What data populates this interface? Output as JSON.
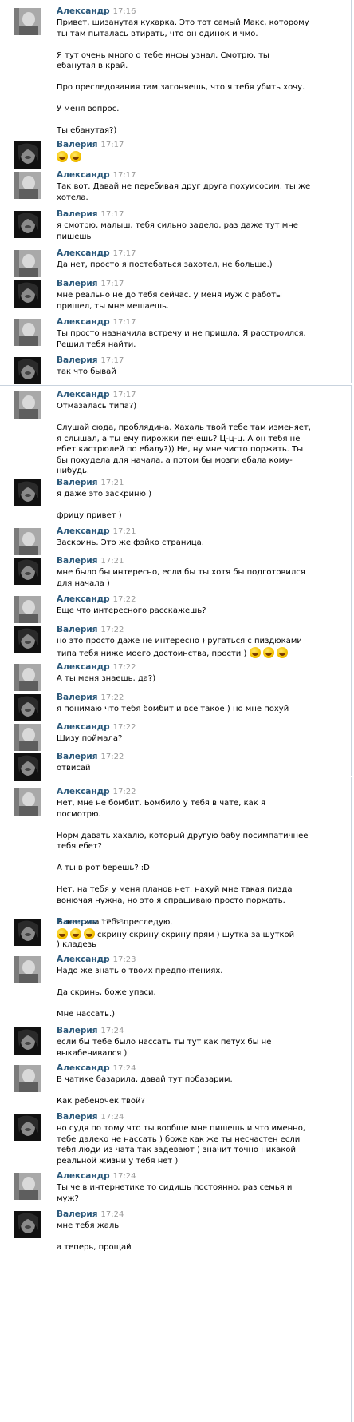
{
  "authors": {
    "alex": "Александр",
    "val": "Валерия"
  },
  "colors": {
    "author": "#2b587a",
    "time": "#999999",
    "border": "#c9d3de",
    "emoji": "#f5c400"
  },
  "messages": [
    {
      "a": "alex",
      "t": "17:16",
      "lines": [
        "Привет, шизанутая кухарка. Это тот самый Макс, которому",
        "ты там пыталась втирать, что он одинок и чмо.",
        "",
        "Я тут очень много о тебе инфы узнал. Смотрю, ты",
        "ебанутая в край.",
        "",
        "Про преследования там загоняешь, что я тебя убить хочу.",
        "",
        "У меня вопрос.",
        "",
        "Ты ебанутая?)"
      ]
    },
    {
      "a": "val",
      "t": "17:17",
      "lines": [
        {
          "emoji": 2,
          "text": ""
        }
      ]
    },
    {
      "a": "alex",
      "t": "17:17",
      "lines": [
        "Так вот. Давай не перебивая друг друга похуисосим, ты же",
        "хотела."
      ]
    },
    {
      "a": "val",
      "t": "17:17",
      "lines": [
        "я смотрю, малыш, тебя сильно задело, раз даже тут мне",
        "пишешь"
      ]
    },
    {
      "a": "alex",
      "t": "17:17",
      "lines": [
        "Да нет, просто я постебаться захотел, не больше.)"
      ]
    },
    {
      "a": "val",
      "t": "17:17",
      "lines": [
        "мне реально не до тебя сейчас. у меня муж с работы",
        "пришел, ты мне мешаешь."
      ]
    },
    {
      "a": "alex",
      "t": "17:17",
      "lines": [
        "Ты просто назначила встречу и не пришла. Я расстроился.",
        "Решил тебя найти."
      ]
    },
    {
      "a": "val",
      "t": "17:17",
      "lines": [
        "так что бывай"
      ]
    },
    {
      "a": "alex",
      "t": "17:17",
      "lines": [
        "Отмазалась типа?)",
        "",
        "Слушай сюда, проблядина. Хахаль твой тебе там изменяет,",
        "я слышал, а ты ему пирожки печешь? Ц-ц-ц. А он тебя не",
        "ебет кастрюлей по ебалу?)) Не, ну мне чисто поржать. Ты",
        "бы похудела для начала, а потом бы мозги ебала кому-",
        "нибудь."
      ]
    },
    {
      "a": "val",
      "t": "17:21",
      "lines": [
        "я даже это заскриню )",
        "",
        "фрицу привет )"
      ]
    },
    {
      "a": "alex",
      "t": "17:21",
      "lines": [
        "Заскринь. Это же фэйко страница."
      ]
    },
    {
      "a": "val",
      "t": "17:21",
      "lines": [
        "мне было бы интересно, если бы ты хотя бы подготовился",
        "для начала )"
      ]
    },
    {
      "a": "alex",
      "t": "17:22",
      "lines": [
        "Еще что интересного расскажешь?"
      ]
    },
    {
      "a": "val",
      "t": "17:22",
      "lines": [
        "но это просто даже не интересно ) ругаться с пиздюками",
        {
          "emoji": 3,
          "text": "типа тебя ниже моего достоинства, прости )"
        }
      ]
    },
    {
      "a": "alex",
      "t": "17:22",
      "lines": [
        "А ты меня знаешь, да?)"
      ]
    },
    {
      "a": "val",
      "t": "17:22",
      "lines": [
        "я понимаю что тебя бомбит и все такое ) но мне похуй"
      ]
    },
    {
      "a": "alex",
      "t": "17:22",
      "lines": [
        "Шизу поймала?"
      ]
    },
    {
      "a": "val",
      "t": "17:22",
      "lines": [
        "отвисай"
      ]
    },
    {
      "a": "alex",
      "t": "17:22",
      "lines": [
        "Нет, мне не бомбит. Бомбило у тебя в чате, как я",
        "посмотрю.",
        "",
        "Норм давать хахалю, который другую бабу посимпатичнее",
        "тебя ебет?",
        "",
        "А ты в рот берешь? :D",
        "",
        "Нет, на тебя у меня планов нет, нахуй мне такая пизда",
        "вонючая нужна, но это я спрашиваю просто поржать.",
        "",
        "Я же типа тебя преследую."
      ]
    },
    {
      "a": "val",
      "t": "17:23",
      "lines": [
        {
          "emoji": 3,
          "text": "скрину скрину скрину прям ) шутка за шуткой",
          "lead": true
        },
        ") кладезь"
      ]
    },
    {
      "a": "alex",
      "t": "17:23",
      "lines": [
        "Надо же знать о твоих предпочтениях.",
        "",
        "Да скринь, боже упаси.",
        "",
        "Мне нассать.)"
      ]
    },
    {
      "a": "val",
      "t": "17:24",
      "lines": [
        "если бы тебе было нассать ты тут как петух бы не",
        "выкабенивался )"
      ]
    },
    {
      "a": "alex",
      "t": "17:24",
      "lines": [
        "В чатике базарила, давай тут побазарим.",
        "",
        "Как ребеночек твой?"
      ]
    },
    {
      "a": "val",
      "t": "17:24",
      "lines": [
        "но судя по тому что ты вообще мне пишешь и что именно,",
        "тебе далеко не нассать ) боже как же ты несчастен если",
        "тебя люди из чата так задевают ) значит точно никакой",
        "реальной жизни у тебя нет )"
      ]
    },
    {
      "a": "alex",
      "t": "17:24",
      "lines": [
        "Ты че в интернетике то сидишь постоянно, раз семья и",
        "муж?"
      ]
    },
    {
      "a": "val",
      "t": "17:24",
      "lines": [
        "мне тебя жаль",
        "",
        "а теперь, прощай"
      ]
    }
  ]
}
